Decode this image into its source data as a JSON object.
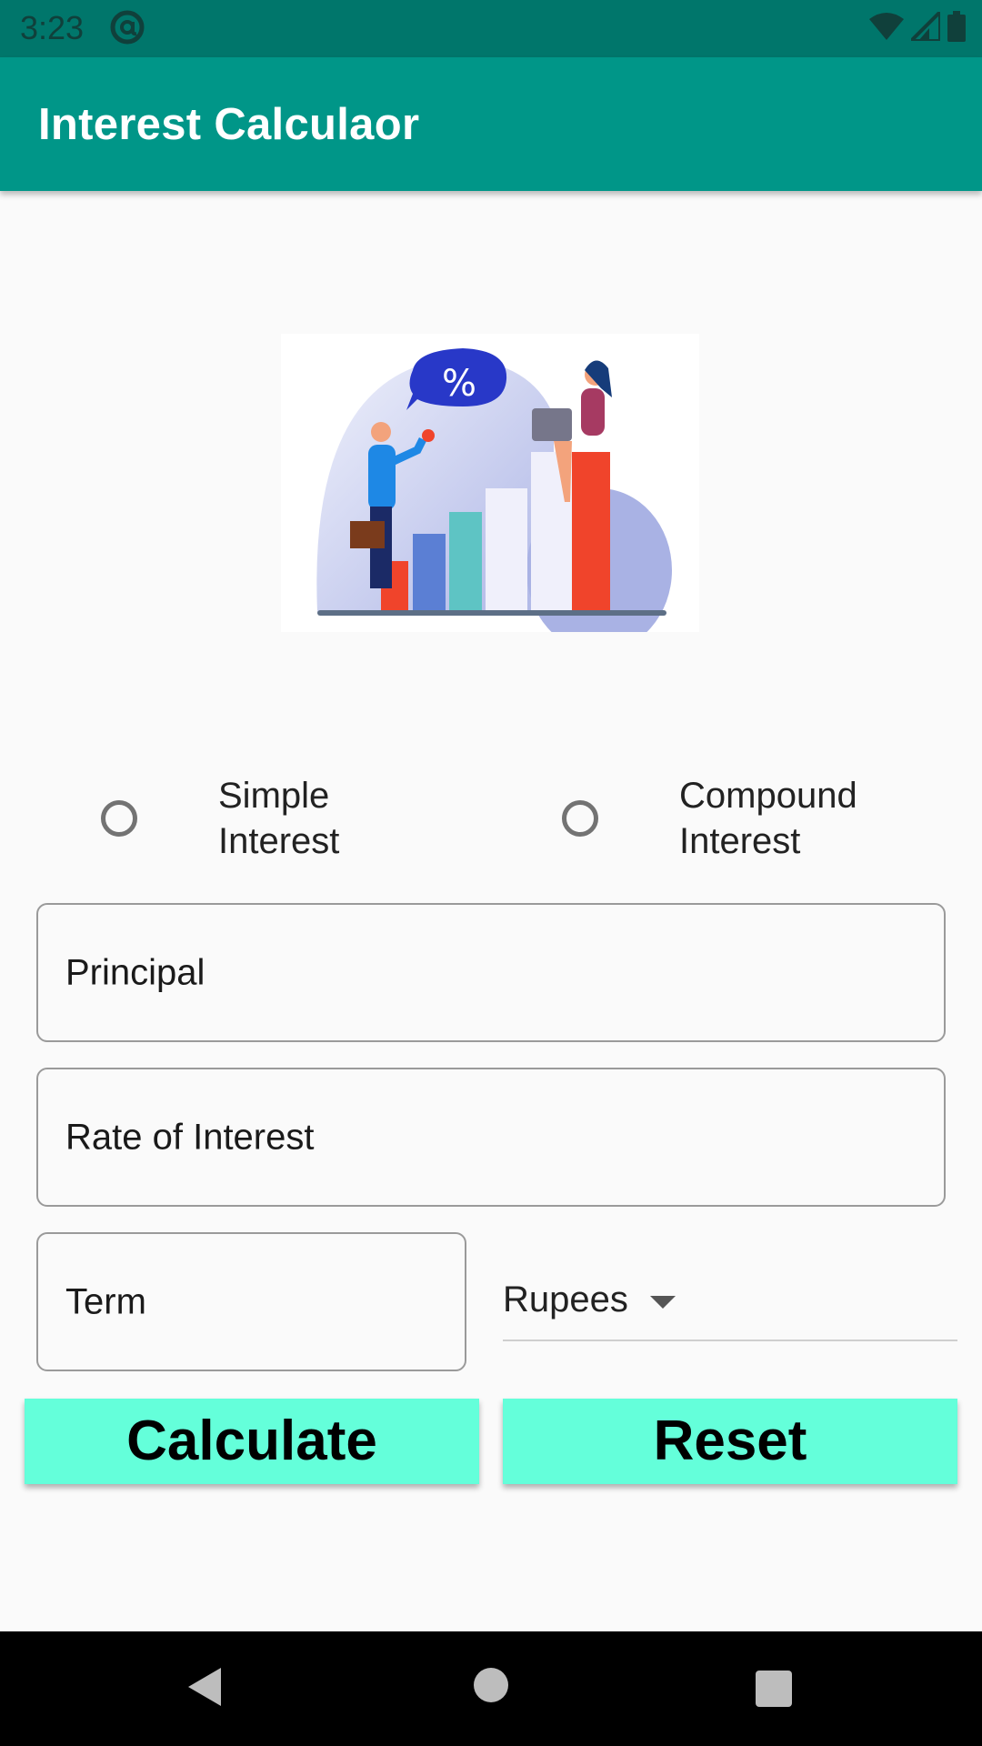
{
  "status_bar": {
    "time": "3:23",
    "icons": [
      "at-sign-icon",
      "wifi-icon",
      "signal-icon",
      "battery-icon"
    ]
  },
  "app_bar": {
    "title": "Interest Calculaor"
  },
  "illustration": {
    "icon": "finance-illustration",
    "badge_text": "%"
  },
  "radio_options": [
    {
      "label_line1": "Simple",
      "label_line2": "Interest",
      "selected": false
    },
    {
      "label_line1": "Compound",
      "label_line2": "Interest",
      "selected": false
    }
  ],
  "fields": {
    "principal_placeholder": "Principal",
    "rate_placeholder": "Rate of Interest",
    "term_placeholder": "Term"
  },
  "spinner": {
    "selected": "Rupees"
  },
  "buttons": {
    "calculate": "Calculate",
    "reset": "Reset"
  },
  "colors": {
    "appbar": "#009688",
    "statusbar": "#00766b",
    "button": "#64ffda"
  },
  "nav_bar": {
    "icons": [
      "back-icon",
      "home-icon",
      "recent-apps-icon"
    ]
  }
}
